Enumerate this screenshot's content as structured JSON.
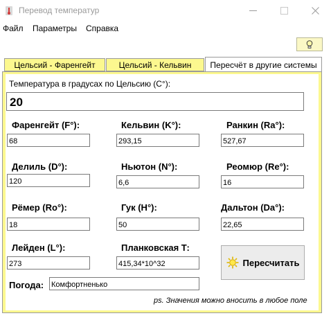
{
  "window": {
    "title": "Перевод температур"
  },
  "menu": [
    "Файл",
    "Параметры",
    "Справка"
  ],
  "toolbar": {
    "bulb_icon": "lightbulb-icon"
  },
  "tabs": [
    {
      "label": "Цельсий - Фаренгейт",
      "active": false
    },
    {
      "label": "Цельсий - Кельвин",
      "active": false
    },
    {
      "label": "Пересчёт в другие системы",
      "active": true
    }
  ],
  "input": {
    "label": "Температура в градусах по Цельсию (С°):",
    "value": "20"
  },
  "scales": {
    "fahrenheit": {
      "label": "Фаренгейт (F°):",
      "value": "68"
    },
    "kelvin": {
      "label": "Кельвин (K°):",
      "value": "293,15"
    },
    "rankine": {
      "label": "Ранкин (Ra°):",
      "value": "527,67"
    },
    "delisle": {
      "label": "Делиль (D°):",
      "value": "120"
    },
    "newton": {
      "label": "Ньютон (N°):",
      "value": "6,6"
    },
    "reaumur": {
      "label": "Реомюр (Re°):",
      "value": "16"
    },
    "romer": {
      "label": "Рёмер (Ro°):",
      "value": "18"
    },
    "hooke": {
      "label": "Гук (H°):",
      "value": "50"
    },
    "dalton": {
      "label": "Дальтон (Da°):",
      "value": "22,65"
    },
    "leiden": {
      "label": "Лейден (L°):",
      "value": "273"
    },
    "planck": {
      "label": "Планковская Т:",
      "value": "415,34*10^32"
    }
  },
  "weather": {
    "label": "Погода:",
    "value": "Комфортненько"
  },
  "recalc_button": {
    "label": "Пересчитать",
    "icon": "sun-icon"
  },
  "note": "ps. Значения можно вносить в любое поле",
  "colors": {
    "accent_yellow": "#fcf88f",
    "bulb_bg": "#fbf8c6"
  }
}
